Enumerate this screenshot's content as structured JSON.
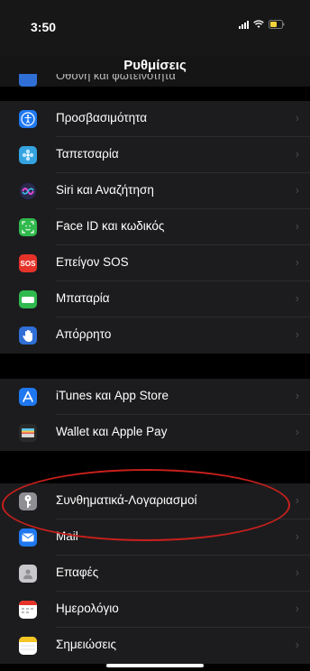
{
  "status_bar": {
    "time": "3:50",
    "icons": [
      "signal-icon",
      "wifi-icon",
      "battery-icon"
    ]
  },
  "header": {
    "title": "Ρυθμίσεις",
    "clipped_row_label": "Οθόνη και φωτεινότητα"
  },
  "group1": [
    {
      "label": "Προσβασιμότητα",
      "icon": "accessibility-icon",
      "color": "#1f78f0"
    },
    {
      "label": "Ταπετσαρία",
      "icon": "wallpaper-icon",
      "color": "#34a3e0"
    },
    {
      "label": "Siri και Αναζήτηση",
      "icon": "siri-icon",
      "color": "#2a2a4a"
    },
    {
      "label": "Face ID και κωδικός",
      "icon": "faceid-icon",
      "color": "#30b94d"
    },
    {
      "label": "Επείγον SOS",
      "icon_text": "SOS",
      "icon": "sos-icon",
      "color": "#e5332a"
    },
    {
      "label": "Μπαταρία",
      "icon": "battery-settings-icon",
      "color": "#30b94d"
    },
    {
      "label": "Απόρρητο",
      "icon": "privacy-hand-icon",
      "color": "#2f6fd6"
    }
  ],
  "group2": [
    {
      "label": "iTunes και App Store",
      "icon": "appstore-icon",
      "color": "#1f78f0"
    },
    {
      "label": "Wallet και Apple Pay",
      "icon": "wallet-icon",
      "color": "#2a2a2a"
    }
  ],
  "group3": [
    {
      "label": "Συνθηματικά-Λογαριασμοί",
      "icon": "passwords-key-icon",
      "color": "#8e8e93",
      "highlighted": true
    },
    {
      "label": "Mail",
      "icon": "mail-icon",
      "color": "#1f78f0"
    },
    {
      "label": "Επαφές",
      "icon": "contacts-icon",
      "color": "#8e8e93"
    },
    {
      "label": "Ημερολόγιο",
      "icon": "calendar-icon",
      "color": "#ffffff"
    },
    {
      "label": "Σημειώσεις",
      "icon": "notes-icon",
      "color": "#ffffff"
    }
  ],
  "chevron": "›"
}
